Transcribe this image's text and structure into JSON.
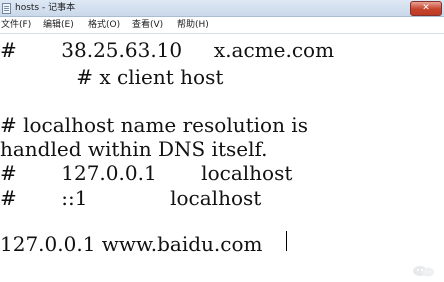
{
  "window": {
    "title": "hosts - 记事本",
    "close_symbol": "✕"
  },
  "menu": {
    "items": [
      {
        "label": "文件(F)"
      },
      {
        "label": "编辑(E)"
      },
      {
        "label": "格式(O)"
      },
      {
        "label": "查看(V)"
      },
      {
        "label": "帮助(H)"
      }
    ]
  },
  "editor": {
    "lines": [
      "#       38.25.63.10     x.acme.com",
      "            # x client host",
      "",
      "# localhost name resolution is",
      "handled within DNS itself.",
      "#       127.0.0.1       localhost",
      "#       ::1             localhost",
      "",
      "127.0.0.1 www.baidu.com"
    ]
  },
  "icons": {
    "app": "notepad-icon",
    "close": "close-icon",
    "watermark": "wechat-watermark-icon"
  }
}
